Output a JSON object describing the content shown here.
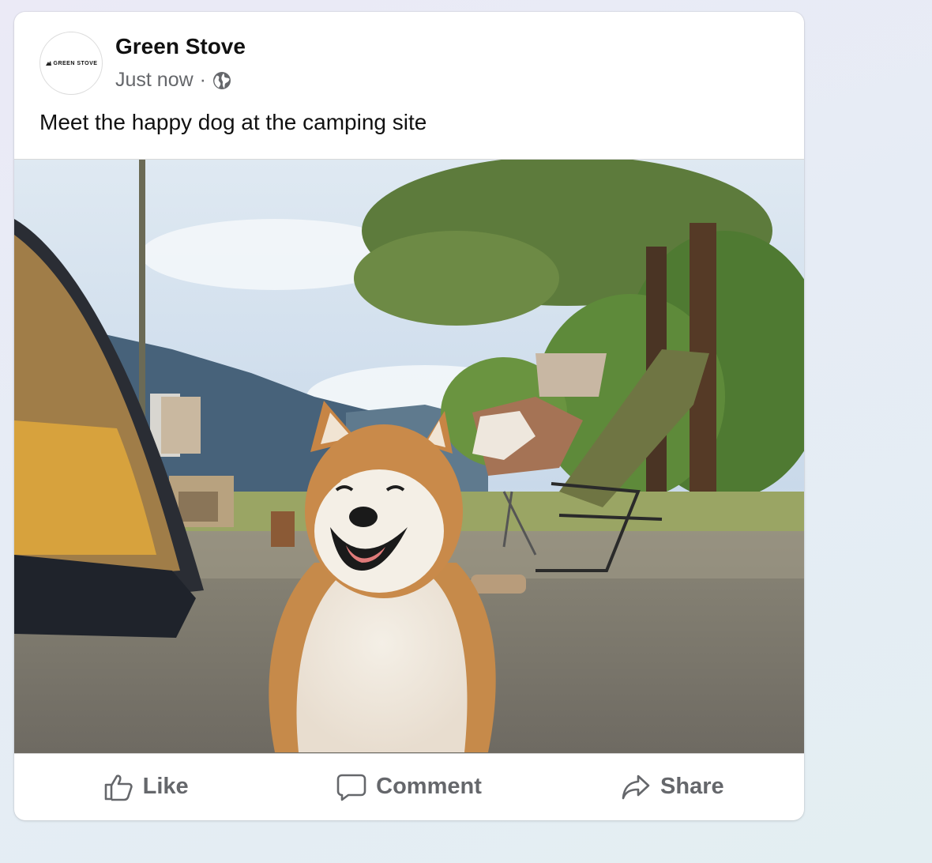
{
  "post": {
    "page_name": "Green Stove",
    "avatar_logo_text": "GREEN STOVE",
    "timestamp": "Just now",
    "separator": "·",
    "audience_icon": "globe-icon",
    "text": "Meet the happy dog at the camping site",
    "photo": "shiba-inu-dog-at-campsite"
  },
  "actions": [
    {
      "label": "Like",
      "icon": "thumbs-up-icon"
    },
    {
      "label": "Comment",
      "icon": "comment-icon"
    },
    {
      "label": "Share",
      "icon": "share-icon"
    }
  ],
  "colors": {
    "text_primary": "#111111",
    "text_secondary": "#65676b",
    "card_background": "#ffffff"
  }
}
